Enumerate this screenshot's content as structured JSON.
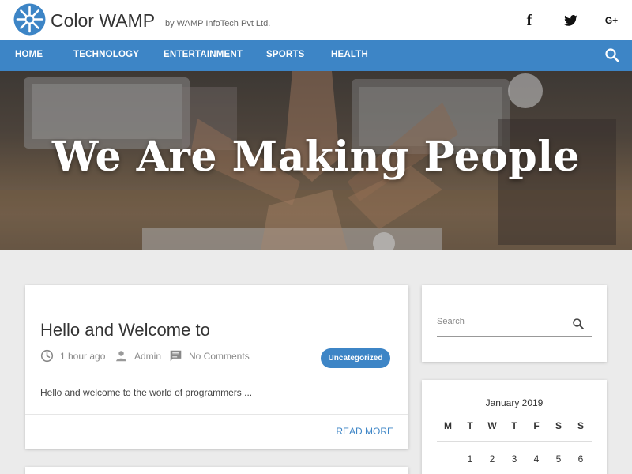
{
  "header": {
    "brand": "Color WAMP",
    "byline": "by WAMP InfoTech Pvt Ltd.",
    "social": {
      "facebook": "f",
      "google_plus": "G+"
    }
  },
  "nav": {
    "items": [
      "HOME",
      "TECHNOLOGY",
      "ENTERTAINMENT",
      "SPORTS",
      "HEALTH"
    ]
  },
  "hero": {
    "title": "We Are Making People"
  },
  "post": {
    "title": "Hello and Welcome to",
    "time": "1 hour ago",
    "author": "Admin",
    "comments": "No Comments",
    "category": "Uncategorized",
    "excerpt": "Hello and welcome to the world of programmers ...",
    "read_more": "READ MORE"
  },
  "search": {
    "placeholder": "Search"
  },
  "calendar": {
    "title": "January 2019",
    "weekdays": [
      "M",
      "T",
      "W",
      "T",
      "F",
      "S",
      "S"
    ],
    "first_row": [
      "",
      "1",
      "2",
      "3",
      "4",
      "5",
      "6"
    ]
  },
  "colors": {
    "accent": "#3d85c6",
    "background": "#ebebeb"
  }
}
